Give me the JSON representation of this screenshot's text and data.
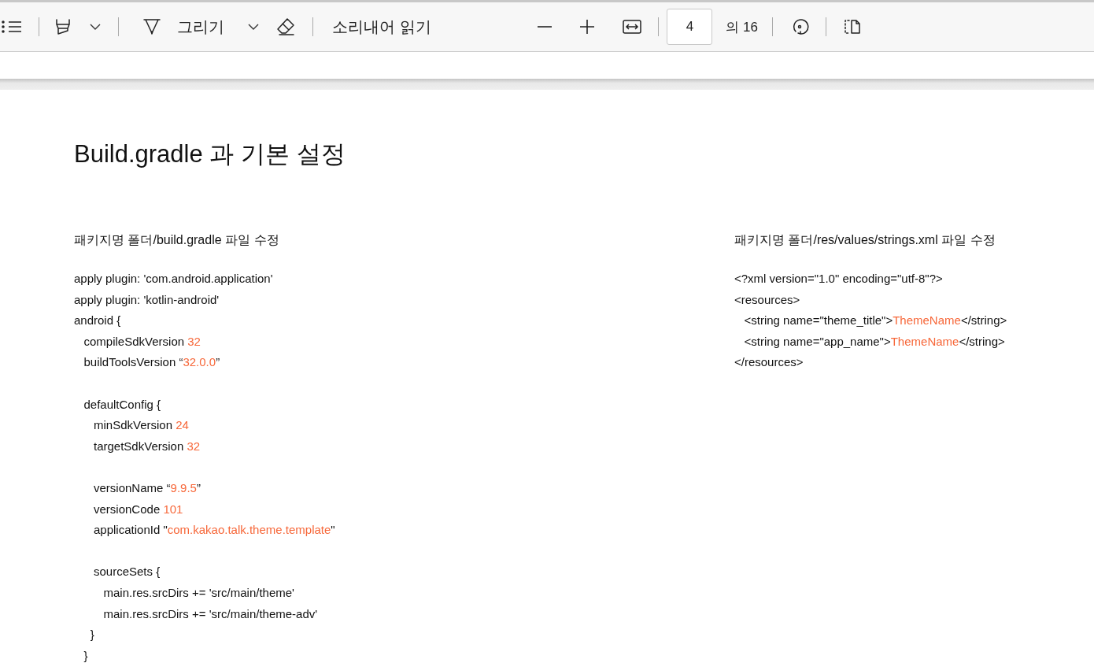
{
  "toolbar": {
    "draw_label": "그리기",
    "read_aloud_label": "소리내어 읽기",
    "page_field": {
      "value": "4"
    },
    "page_count": "의 16"
  },
  "page": {
    "title": "Build.gradle 과 기본 설정",
    "columns": [
      {
        "heading": "패키지명 폴더/build.gradle 파일 수정",
        "lines": [
          {
            "kind": "code",
            "segments": [
              {
                "text": "apply plugin: 'com.android.application'",
                "kind": "plain"
              }
            ]
          },
          {
            "kind": "code",
            "segments": [
              {
                "text": "apply plugin: 'kotlin-android'",
                "kind": "plain"
              }
            ]
          },
          {
            "kind": "code",
            "segments": [
              {
                "text": "android {",
                "kind": "plain"
              }
            ]
          },
          {
            "kind": "code",
            "segments": [
              {
                "text": "   compileSdkVersion ",
                "kind": "plain"
              },
              {
                "text": "32",
                "kind": "value"
              }
            ]
          },
          {
            "kind": "code",
            "segments": [
              {
                "text": "   buildToolsVersion “",
                "kind": "plain"
              },
              {
                "text": "32.0.0",
                "kind": "value"
              },
              {
                "text": "”",
                "kind": "plain"
              }
            ]
          },
          {
            "kind": "blank"
          },
          {
            "kind": "code",
            "segments": [
              {
                "text": "   defaultConfig {",
                "kind": "plain"
              }
            ]
          },
          {
            "kind": "code",
            "segments": [
              {
                "text": "      minSdkVersion ",
                "kind": "plain"
              },
              {
                "text": "24",
                "kind": "value"
              }
            ]
          },
          {
            "kind": "code",
            "segments": [
              {
                "text": "      targetSdkVersion ",
                "kind": "plain"
              },
              {
                "text": "32",
                "kind": "value"
              }
            ]
          },
          {
            "kind": "blank"
          },
          {
            "kind": "code",
            "segments": [
              {
                "text": "      versionName “",
                "kind": "plain"
              },
              {
                "text": "9.9.5",
                "kind": "value"
              },
              {
                "text": "”",
                "kind": "plain"
              }
            ]
          },
          {
            "kind": "code",
            "segments": [
              {
                "text": "      versionCode ",
                "kind": "plain"
              },
              {
                "text": "101",
                "kind": "value"
              }
            ]
          },
          {
            "kind": "code",
            "segments": [
              {
                "text": "      applicationId \"",
                "kind": "plain"
              },
              {
                "text": "com.kakao.talk.theme.template",
                "kind": "value"
              },
              {
                "text": "\"",
                "kind": "plain"
              }
            ]
          },
          {
            "kind": "blank"
          },
          {
            "kind": "code",
            "segments": [
              {
                "text": "      sourceSets {",
                "kind": "plain"
              }
            ]
          },
          {
            "kind": "code",
            "segments": [
              {
                "text": "         main.res.srcDirs += 'src/main/theme'",
                "kind": "plain"
              }
            ]
          },
          {
            "kind": "code",
            "segments": [
              {
                "text": "         main.res.srcDirs += 'src/main/theme-adv'",
                "kind": "plain"
              }
            ]
          },
          {
            "kind": "code",
            "segments": [
              {
                "text": "     }",
                "kind": "plain"
              }
            ]
          },
          {
            "kind": "code",
            "segments": [
              {
                "text": "   }",
                "kind": "plain"
              }
            ]
          }
        ]
      },
      {
        "heading": "패키지명 폴더/res/values/strings.xml 파일 수정",
        "lines": [
          {
            "kind": "code",
            "segments": [
              {
                "text": "<?xml version=\"1.0\" encoding=\"utf-8\"?>",
                "kind": "plain"
              }
            ]
          },
          {
            "kind": "code",
            "segments": [
              {
                "text": "<resources>",
                "kind": "plain"
              }
            ]
          },
          {
            "kind": "code",
            "segments": [
              {
                "text": "   <string name=\"theme_title\">",
                "kind": "plain"
              },
              {
                "text": "ThemeName",
                "kind": "value"
              },
              {
                "text": "</string>",
                "kind": "plain"
              }
            ]
          },
          {
            "kind": "code",
            "segments": [
              {
                "text": "   <string name=\"app_name\">",
                "kind": "plain"
              },
              {
                "text": "ThemeName",
                "kind": "value"
              },
              {
                "text": "</string>",
                "kind": "plain"
              }
            ]
          },
          {
            "kind": "code",
            "segments": [
              {
                "text": "</resources>",
                "kind": "plain"
              }
            ]
          }
        ]
      }
    ]
  }
}
